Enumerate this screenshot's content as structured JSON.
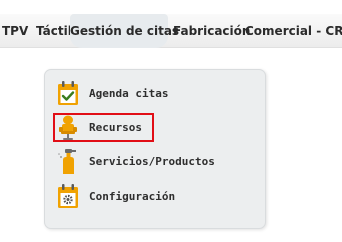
{
  "menubar": {
    "items": [
      {
        "label": "TPV"
      },
      {
        "label": "Táctil"
      },
      {
        "label": "Gestión de citas"
      },
      {
        "label": "Fabricación"
      },
      {
        "label": "Comercial - CRM"
      }
    ]
  },
  "dropdown": {
    "items": [
      {
        "label": "Agenda citas",
        "icon": "calendar-check-icon"
      },
      {
        "label": "Recursos",
        "icon": "resource-chair-icon"
      },
      {
        "label": "Servicios/Productos",
        "icon": "spray-bottle-icon"
      },
      {
        "label": "Configuración",
        "icon": "calendar-gear-icon"
      }
    ],
    "highlighted": "Recursos"
  },
  "colors": {
    "icon_orange": "#f0a202",
    "highlight_border": "#e10e16",
    "dropdown_bg": "#eceeef",
    "check_green": "#3a7d1e"
  }
}
